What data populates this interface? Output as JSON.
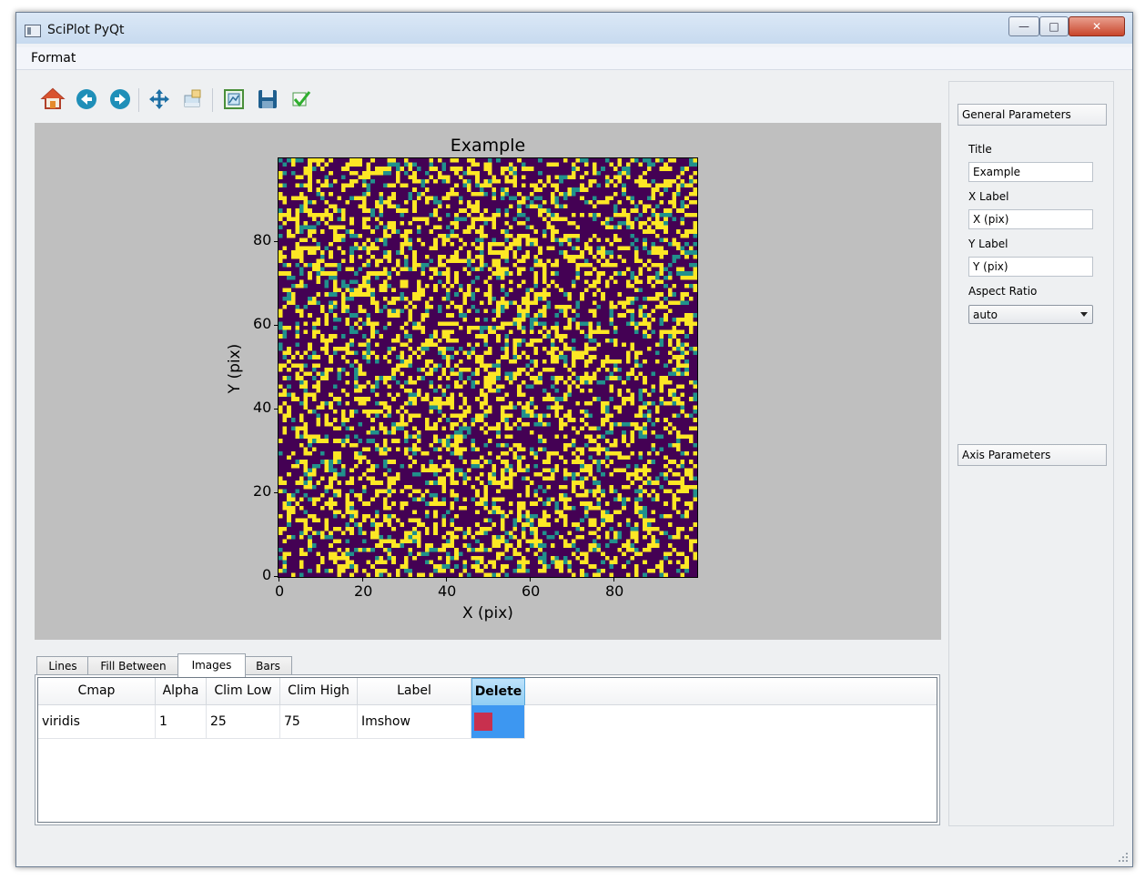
{
  "window": {
    "title": "SciPlot PyQt"
  },
  "menu": {
    "items": [
      "Format"
    ]
  },
  "toolbar": {
    "icons": [
      "home-icon",
      "back-icon",
      "forward-icon",
      "pan-icon",
      "zoom-icon",
      "configure-subplots-icon",
      "save-icon",
      "check-icon"
    ]
  },
  "plot": {
    "title": "Example",
    "xlabel": "X (pix)",
    "ylabel": "Y (pix)",
    "xticks": [
      "0",
      "20",
      "40",
      "60",
      "80"
    ],
    "yticks": [
      "0",
      "20",
      "40",
      "60",
      "80"
    ]
  },
  "chart_data": {
    "type": "heatmap",
    "title": "Example",
    "xlabel": "X (pix)",
    "ylabel": "Y (pix)",
    "xlim": [
      0,
      100
    ],
    "ylim": [
      0,
      100
    ],
    "xticks": [
      0,
      20,
      40,
      60,
      80
    ],
    "yticks": [
      0,
      20,
      40,
      60,
      80
    ],
    "grid_shape": [
      100,
      100
    ],
    "colormap": "viridis",
    "clim": [
      25,
      75
    ],
    "colors": {
      "low": "#440154",
      "mid": "#21918c",
      "high": "#fde725"
    }
  },
  "tabs": [
    {
      "label": "Lines",
      "active": false
    },
    {
      "label": "Fill Between",
      "active": false
    },
    {
      "label": "Images",
      "active": true
    },
    {
      "label": "Bars",
      "active": false
    }
  ],
  "table": {
    "headers": [
      "Cmap",
      "Alpha",
      "Clim Low",
      "Clim High",
      "Label",
      "Delete"
    ],
    "rows": [
      {
        "cmap": "viridis",
        "alpha": "1",
        "clim_low": "25",
        "clim_high": "75",
        "label": "Imshow"
      }
    ]
  },
  "side": {
    "general_header": "General Parameters",
    "title_label": "Title",
    "title_value": "Example",
    "xlabel_label": "X Label",
    "xlabel_value": "X (pix)",
    "ylabel_label": "Y Label",
    "ylabel_value": "Y (pix)",
    "aspect_label": "Aspect Ratio",
    "aspect_value": "auto",
    "axis_header": "Axis Parameters"
  }
}
